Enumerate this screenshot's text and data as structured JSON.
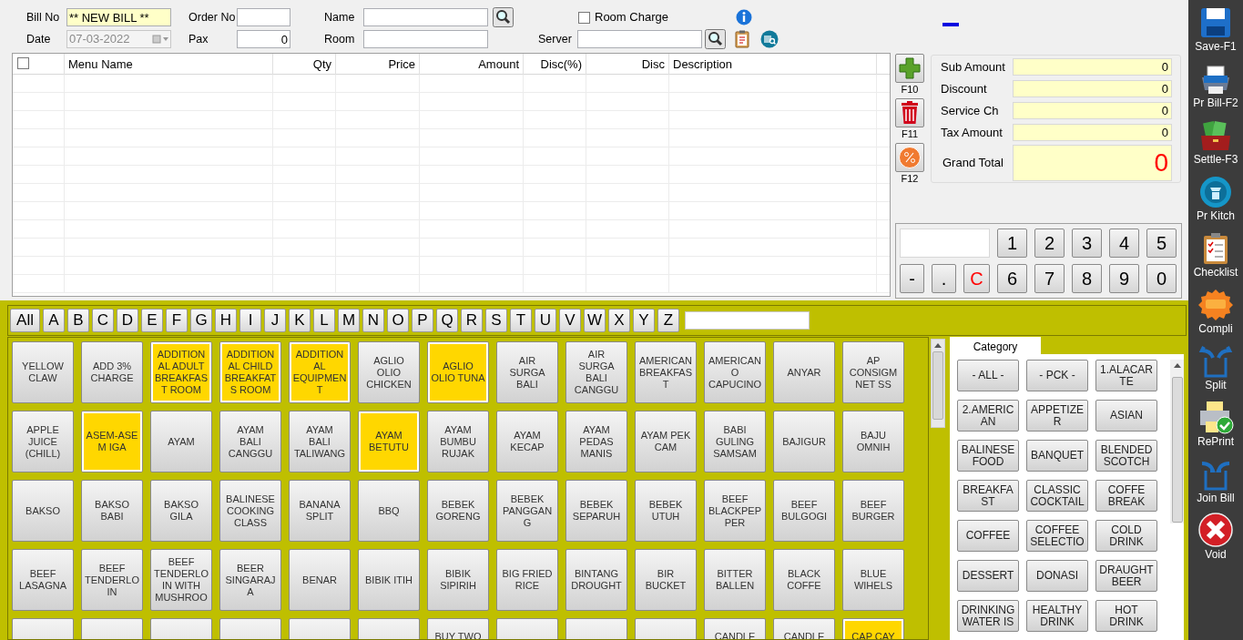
{
  "header": {
    "bill_no_label": "Bill No",
    "bill_no": "** NEW BILL **",
    "date_label": "Date",
    "date": "07-03-2022",
    "date_disabled": true,
    "order_no_label": "Order No",
    "pax_label": "Pax",
    "pax": "0",
    "name_label": "Name",
    "room_label": "Room",
    "room_charge": {
      "label": "Room Charge",
      "checked": false
    },
    "server_label": "Server"
  },
  "order_table": {
    "select_all_checked": false,
    "columns": [
      {
        "label": "Menu Name",
        "kind": "text"
      },
      {
        "label": "Qty",
        "kind": "number"
      },
      {
        "label": "Price",
        "kind": "number"
      },
      {
        "label": "Amount",
        "kind": "number"
      },
      {
        "label": "Disc(%)",
        "kind": "number"
      },
      {
        "label": "Disc",
        "kind": "number"
      },
      {
        "label": "Description",
        "kind": "text"
      }
    ]
  },
  "actions": [
    {
      "kind": "add",
      "key": "F10"
    },
    {
      "kind": "delete",
      "key": "F11"
    },
    {
      "kind": "discount",
      "key": "F12"
    }
  ],
  "totals": [
    {
      "label": "Sub Amount",
      "value": "0",
      "kind": "line"
    },
    {
      "label": "Discount",
      "value": "0",
      "kind": "line"
    },
    {
      "label": "Service Ch",
      "value": "0",
      "kind": "line"
    },
    {
      "label": "Tax Amount",
      "value": "0",
      "kind": "line"
    },
    {
      "label": "Grand Total",
      "value": "0",
      "kind": "grand"
    }
  ],
  "numpad": [
    [
      {
        "label": "1",
        "kind": "digit"
      },
      {
        "label": "2",
        "kind": "digit"
      },
      {
        "label": "3",
        "kind": "digit"
      },
      {
        "label": "4",
        "kind": "digit"
      },
      {
        "label": "5",
        "kind": "digit"
      }
    ],
    [
      {
        "label": "-",
        "kind": "small"
      },
      {
        "label": ".",
        "kind": "small"
      },
      {
        "label": "C",
        "kind": "clear"
      },
      {
        "label": "6",
        "kind": "digit"
      },
      {
        "label": "7",
        "kind": "digit"
      },
      {
        "label": "8",
        "kind": "digit"
      },
      {
        "label": "9",
        "kind": "digit"
      },
      {
        "label": "0",
        "kind": "digit"
      }
    ]
  ],
  "letters": [
    "All",
    "A",
    "B",
    "C",
    "D",
    "E",
    "F",
    "G",
    "H",
    "I",
    "J",
    "K",
    "L",
    "M",
    "N",
    "O",
    "P",
    "Q",
    "R",
    "S",
    "T",
    "U",
    "V",
    "W",
    "X",
    "Y",
    "Z"
  ],
  "menu_items": [
    {
      "lines": [
        "YELLOW",
        "CLAW"
      ],
      "highlighted": false
    },
    {
      "lines": [
        "ADD 3%",
        "CHARGE"
      ],
      "highlighted": false
    },
    {
      "lines": [
        "ADDITION",
        "AL ADULT",
        "BREAKFAS",
        "T ROOM"
      ],
      "highlighted": true
    },
    {
      "lines": [
        "ADDITION",
        "AL CHILD",
        "BREAKFAT",
        "S ROOM"
      ],
      "highlighted": true
    },
    {
      "lines": [
        "ADDITION",
        "AL",
        "EQUIPMEN",
        "T"
      ],
      "highlighted": true
    },
    {
      "lines": [
        "AGLIO",
        "OLIO",
        "CHICKEN"
      ],
      "highlighted": false
    },
    {
      "lines": [
        "AGLIO",
        "OLIO TUNA"
      ],
      "highlighted": true
    },
    {
      "lines": [
        "AIR",
        "SURGA",
        "BALI"
      ],
      "highlighted": false
    },
    {
      "lines": [
        "AIR",
        "SURGA",
        "BALI",
        "CANGGU"
      ],
      "highlighted": false
    },
    {
      "lines": [
        "AMERICAN",
        "BREAKFAS",
        "T"
      ],
      "highlighted": false
    },
    {
      "lines": [
        "AMERICAN",
        "O",
        "CAPUCINO"
      ],
      "highlighted": false
    },
    {
      "lines": [
        "ANYAR"
      ],
      "highlighted": false
    },
    {
      "lines": [
        "AP",
        "CONSIGM",
        "NET SS"
      ],
      "highlighted": false
    },
    {
      "lines": [
        "APPLE",
        "JUICE",
        "(CHILL)"
      ],
      "highlighted": false
    },
    {
      "lines": [
        "ASEM-ASE",
        "M IGA"
      ],
      "highlighted": true
    },
    {
      "lines": [
        "AYAM"
      ],
      "highlighted": false
    },
    {
      "lines": [
        "AYAM",
        "BALI",
        "CANGGU"
      ],
      "highlighted": false
    },
    {
      "lines": [
        "AYAM",
        "BALI",
        "TALIWANG"
      ],
      "highlighted": false
    },
    {
      "lines": [
        "AYAM",
        "BETUTU"
      ],
      "highlighted": true
    },
    {
      "lines": [
        "AYAM",
        "BUMBU",
        "RUJAK"
      ],
      "highlighted": false
    },
    {
      "lines": [
        "AYAM",
        "KECAP"
      ],
      "highlighted": false
    },
    {
      "lines": [
        "AYAM",
        "PEDAS",
        "MANIS"
      ],
      "highlighted": false
    },
    {
      "lines": [
        "AYAM PEK",
        "CAM"
      ],
      "highlighted": false
    },
    {
      "lines": [
        "BABI",
        "GULING",
        "SAMSAM"
      ],
      "highlighted": false
    },
    {
      "lines": [
        "BAJIGUR"
      ],
      "highlighted": false
    },
    {
      "lines": [
        "BAJU",
        "OMNIH"
      ],
      "highlighted": false
    },
    {
      "lines": [
        "BAKSO"
      ],
      "highlighted": false
    },
    {
      "lines": [
        "BAKSO",
        "BABI"
      ],
      "highlighted": false
    },
    {
      "lines": [
        "BAKSO",
        "GILA"
      ],
      "highlighted": false
    },
    {
      "lines": [
        "BALINESE",
        "COOKING",
        "CLASS"
      ],
      "highlighted": false
    },
    {
      "lines": [
        "BANANA",
        "SPLIT"
      ],
      "highlighted": false
    },
    {
      "lines": [
        "BBQ"
      ],
      "highlighted": false
    },
    {
      "lines": [
        "BEBEK",
        "GORENG"
      ],
      "highlighted": false
    },
    {
      "lines": [
        "BEBEK",
        "PANGGAN",
        "G"
      ],
      "highlighted": false
    },
    {
      "lines": [
        "BEBEK",
        "SEPARUH"
      ],
      "highlighted": false
    },
    {
      "lines": [
        "BEBEK",
        "UTUH"
      ],
      "highlighted": false
    },
    {
      "lines": [
        "BEEF",
        "BLACKPEP",
        "PER"
      ],
      "highlighted": false
    },
    {
      "lines": [
        "BEEF",
        "BULGOGI"
      ],
      "highlighted": false
    },
    {
      "lines": [
        "BEEF",
        "BURGER"
      ],
      "highlighted": false
    },
    {
      "lines": [
        "BEEF",
        "LASAGNA"
      ],
      "highlighted": false
    },
    {
      "lines": [
        "BEEF",
        "TENDERLO",
        "IN"
      ],
      "highlighted": false
    },
    {
      "lines": [
        "BEEF",
        "TENDERLO",
        "IN WITH",
        "MUSHROO"
      ],
      "highlighted": false
    },
    {
      "lines": [
        "BEER",
        "SINGARAJ",
        "A"
      ],
      "highlighted": false
    },
    {
      "lines": [
        "BENAR"
      ],
      "highlighted": false
    },
    {
      "lines": [
        "BIBIK ITIH"
      ],
      "highlighted": false
    },
    {
      "lines": [
        "BIBIK",
        "SIPIRIH"
      ],
      "highlighted": false
    },
    {
      "lines": [
        "BIG FRIED",
        "RICE"
      ],
      "highlighted": false
    },
    {
      "lines": [
        "BINTANG",
        "DROUGHT"
      ],
      "highlighted": false
    },
    {
      "lines": [
        "BIR",
        "BUCKET"
      ],
      "highlighted": false
    },
    {
      "lines": [
        "BITTER",
        "BALLEN"
      ],
      "highlighted": false
    },
    {
      "lines": [
        "BLACK",
        "COFFE"
      ],
      "highlighted": false
    },
    {
      "lines": [
        "BLUE",
        "WIHELS"
      ],
      "highlighted": false
    },
    {
      "highlighted": false
    },
    {
      "highlighted": false
    },
    {
      "highlighted": false
    },
    {
      "highlighted": false
    },
    {
      "highlighted": false
    },
    {
      "highlighted": false
    },
    {
      "lines": [
        "BUY TWO"
      ],
      "highlighted": false
    },
    {
      "highlighted": false
    },
    {
      "highlighted": false
    },
    {
      "highlighted": false
    },
    {
      "lines": [
        "CANDLE"
      ],
      "highlighted": false
    },
    {
      "lines": [
        "CANDLE"
      ],
      "highlighted": false
    },
    {
      "lines": [
        "CAP CAY"
      ],
      "highlighted": true
    }
  ],
  "category_tab": "Category",
  "categories": [
    {
      "lines": [
        "- ALL -"
      ]
    },
    {
      "lines": [
        "- PCK -"
      ]
    },
    {
      "lines": [
        "1.ALACAR",
        "TE"
      ]
    },
    {
      "lines": [
        "2.AMERIC",
        "AN"
      ]
    },
    {
      "lines": [
        "APPETIZE",
        "R"
      ]
    },
    {
      "lines": [
        "ASIAN"
      ]
    },
    {
      "lines": [
        "BALINESE",
        "FOOD"
      ]
    },
    {
      "lines": [
        "BANQUET"
      ]
    },
    {
      "lines": [
        "BLENDED",
        "SCOTCH"
      ]
    },
    {
      "lines": [
        "BREAKFA",
        "ST"
      ]
    },
    {
      "lines": [
        "CLASSIC",
        "COCKTAIL"
      ]
    },
    {
      "lines": [
        "COFFE",
        "BREAK"
      ]
    },
    {
      "lines": [
        "COFFEE"
      ]
    },
    {
      "lines": [
        "COFFEE",
        "SELECTIO"
      ]
    },
    {
      "lines": [
        "COLD",
        "DRINK"
      ]
    },
    {
      "lines": [
        "DESSERT"
      ]
    },
    {
      "lines": [
        "DONASI"
      ]
    },
    {
      "lines": [
        "DRAUGHT",
        "BEER"
      ]
    },
    {
      "lines": [
        "DRINKING",
        "WATER IS"
      ]
    },
    {
      "lines": [
        "HEALTHY",
        "DRINK"
      ]
    },
    {
      "lines": [
        "HOT",
        "DRINK"
      ]
    }
  ],
  "sidebar": [
    {
      "label": "Save-F1",
      "kind": "save"
    },
    {
      "label": "Pr Bill-F2",
      "kind": "print"
    },
    {
      "label": "Settle-F3",
      "kind": "money"
    },
    {
      "label": "Pr Kitch",
      "kind": "kitchen"
    },
    {
      "label": "Checklist",
      "kind": "checklist"
    },
    {
      "label": "Compli",
      "kind": "compli"
    },
    {
      "label": "Split",
      "kind": "split"
    },
    {
      "label": "RePrint",
      "kind": "reprint"
    },
    {
      "label": "Join Bill",
      "kind": "join"
    },
    {
      "label": "Void",
      "kind": "void"
    }
  ]
}
